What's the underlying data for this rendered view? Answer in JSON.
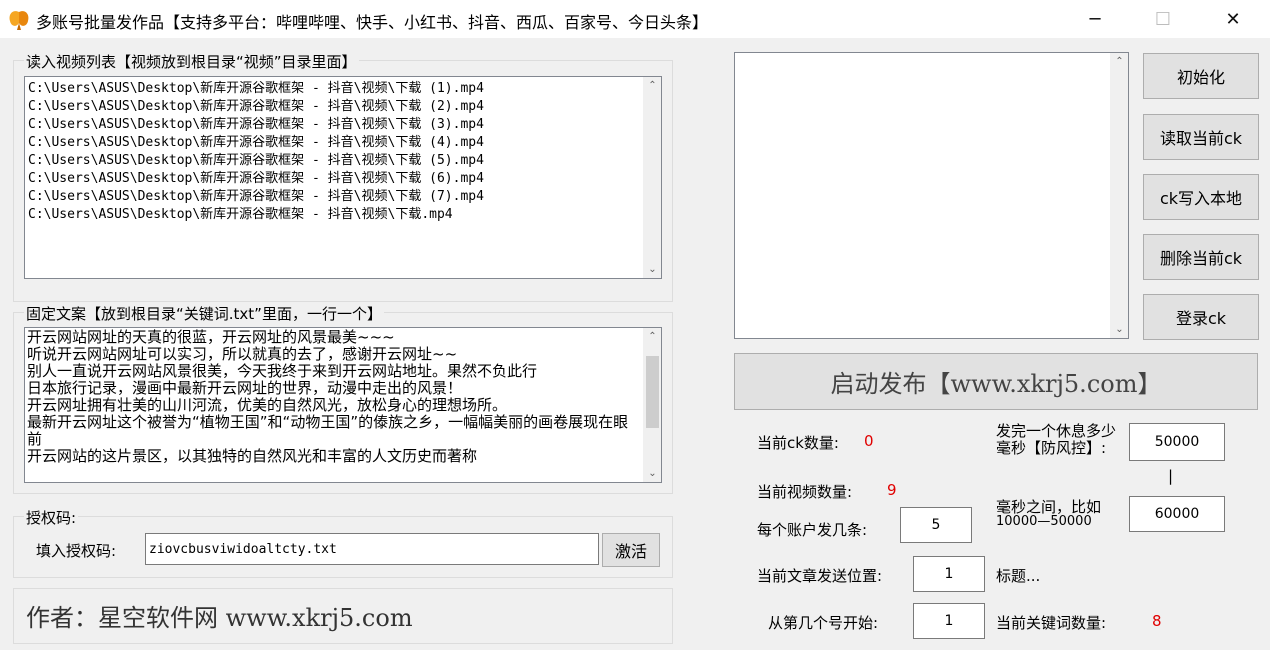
{
  "window": {
    "title": "多账号批量发作品【支持多平台：哔哩哔哩、快手、小红书、抖音、西瓜、百家号、今日头条】",
    "minimize": "─",
    "maximize": "☐",
    "close": "✕"
  },
  "video_group": {
    "label": "读入视频列表【视频放到根目录“视频”目录里面】",
    "files": [
      "C:\\Users\\ASUS\\Desktop\\新库开源谷歌框架 - 抖音\\视频\\下载 (1).mp4",
      "C:\\Users\\ASUS\\Desktop\\新库开源谷歌框架 - 抖音\\视频\\下载 (2).mp4",
      "C:\\Users\\ASUS\\Desktop\\新库开源谷歌框架 - 抖音\\视频\\下载 (3).mp4",
      "C:\\Users\\ASUS\\Desktop\\新库开源谷歌框架 - 抖音\\视频\\下载 (4).mp4",
      "C:\\Users\\ASUS\\Desktop\\新库开源谷歌框架 - 抖音\\视频\\下载 (5).mp4",
      "C:\\Users\\ASUS\\Desktop\\新库开源谷歌框架 - 抖音\\视频\\下载 (6).mp4",
      "C:\\Users\\ASUS\\Desktop\\新库开源谷歌框架 - 抖音\\视频\\下载 (7).mp4",
      "C:\\Users\\ASUS\\Desktop\\新库开源谷歌框架 - 抖音\\视频\\下载.mp4"
    ]
  },
  "keyword_group": {
    "label": "固定文案【放到根目录“关键词.txt”里面，一行一个】",
    "lines": [
      "开云网站网址的天真的很蓝，开云网址的风景最美~~~",
      "听说开云网站网址可以实习，所以就真的去了，感谢开云网址~~",
      "别人一直说开云网站风景很美，今天我终于来到开云网站地址。果然不负此行",
      "日本旅行记录，漫画中最新开云网址的世界，动漫中走出的风景！",
      "开云网址拥有壮美的山川河流，优美的自然风光，放松身心的理想场所。",
      "最新开云网址这个被誉为“植物王国”和“动物王国”的傣族之乡，一幅幅美丽的画卷展现在眼前",
      "开云网站的这片景区，以其独特的自然风光和丰富的人文历史而著称"
    ]
  },
  "license": {
    "group_label": "授权码:",
    "field_label": "填入授权码:",
    "value": "ziovcbusviwidoaltcty.txt",
    "activate": "激活"
  },
  "author": "作者：星空软件网 www.xkrj5.com",
  "side_buttons": {
    "init": "初始化",
    "read_ck": "读取当前ck",
    "write_ck": "ck写入本地",
    "delete_ck": "删除当前ck",
    "login_ck": "登录ck"
  },
  "start_button": "启动发布【www.xkrj5.com】",
  "stats": {
    "ck_count_label": "当前ck数量:",
    "ck_count": "0",
    "video_count_label": "当前视频数量:",
    "video_count": "9",
    "per_account_label": "每个账户发几条:",
    "per_account": "5",
    "article_pos_label": "当前文章发送位置:",
    "article_pos": "1",
    "title_hint": "标题...",
    "start_from_label": "从第几个号开始:",
    "start_from": "1",
    "keyword_count_label": "当前关键词数量:",
    "keyword_count": "8"
  },
  "rest": {
    "label": "发完一个休息多少毫秒【防风控】:",
    "min": "50000",
    "sep": "|",
    "between_label": "毫秒之间，比如",
    "example": "10000—50000",
    "max": "60000"
  }
}
